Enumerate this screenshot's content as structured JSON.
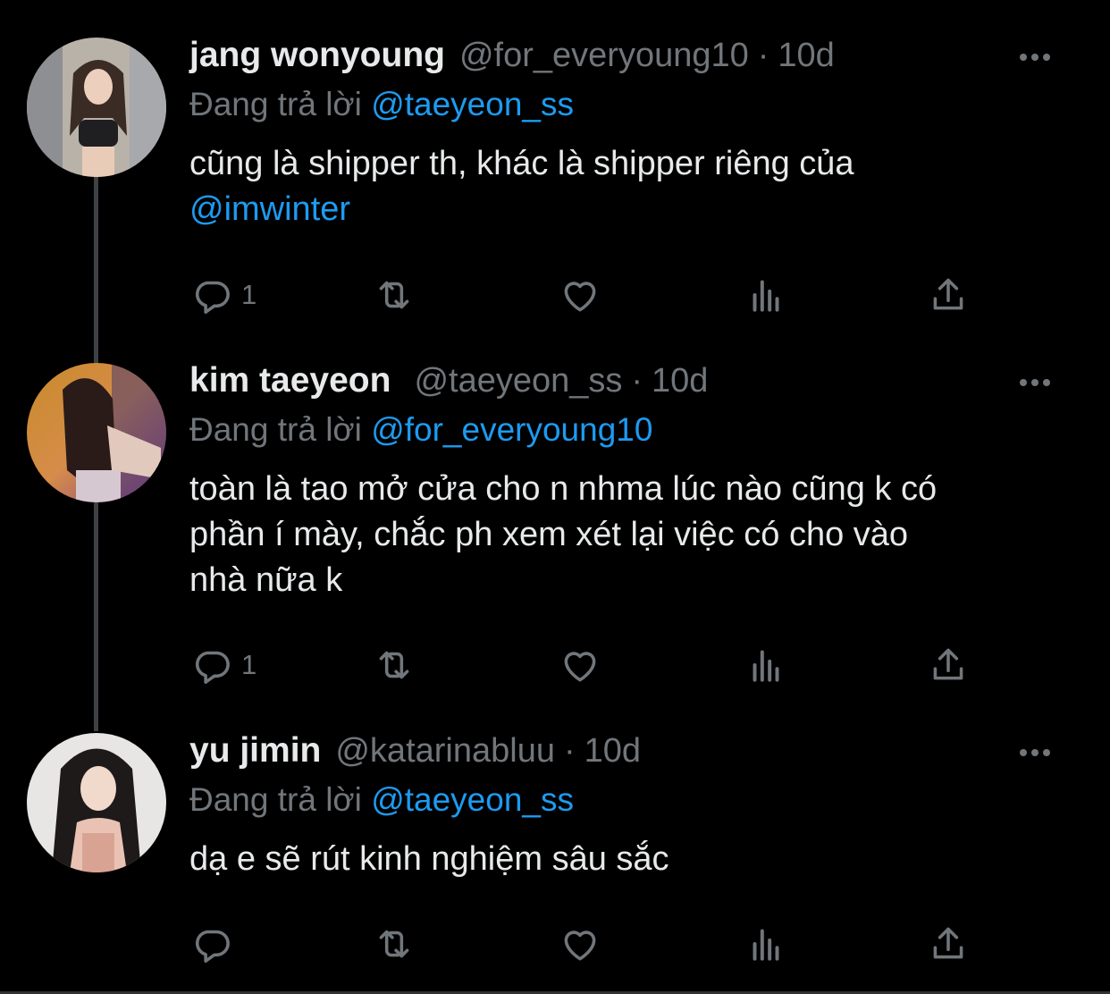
{
  "reply_prefix": "Đang trả lời",
  "colors": {
    "background": "#000000",
    "primary_text": "#e7e9ea",
    "secondary_text": "#71767b",
    "accent": "#1d9bf0",
    "thread_line": "#3e4144"
  },
  "icons": [
    "reply-icon",
    "retweet-icon",
    "like-icon",
    "views-icon",
    "share-icon",
    "more-icon"
  ],
  "tweets": [
    {
      "name": "jang wonyoung",
      "handle": "@for_everyoung10",
      "separator": "·",
      "time": "10d",
      "reply_to": "@taeyeon_ss",
      "text": "cũng là shipper th, khác là shipper riêng của",
      "text_mention": "@imwinter",
      "reply_count": "1"
    },
    {
      "name": "kim taeyeon",
      "handle": "@taeyeon_ss",
      "separator": "·",
      "time": "10d",
      "reply_to": "@for_everyoung10",
      "text": "toàn là tao mở cửa cho n nhma lúc nào cũng k có\nphần í mày, chắc ph xem xét lại việc có cho vào\nnhà nữa k",
      "reply_count": "1"
    },
    {
      "name": "yu jimin",
      "handle": "@katarinabluu",
      "separator": "·",
      "time": "10d",
      "reply_to": "@taeyeon_ss",
      "text": "dạ e sẽ rút kinh nghiệm sâu sắc",
      "reply_count": ""
    }
  ]
}
